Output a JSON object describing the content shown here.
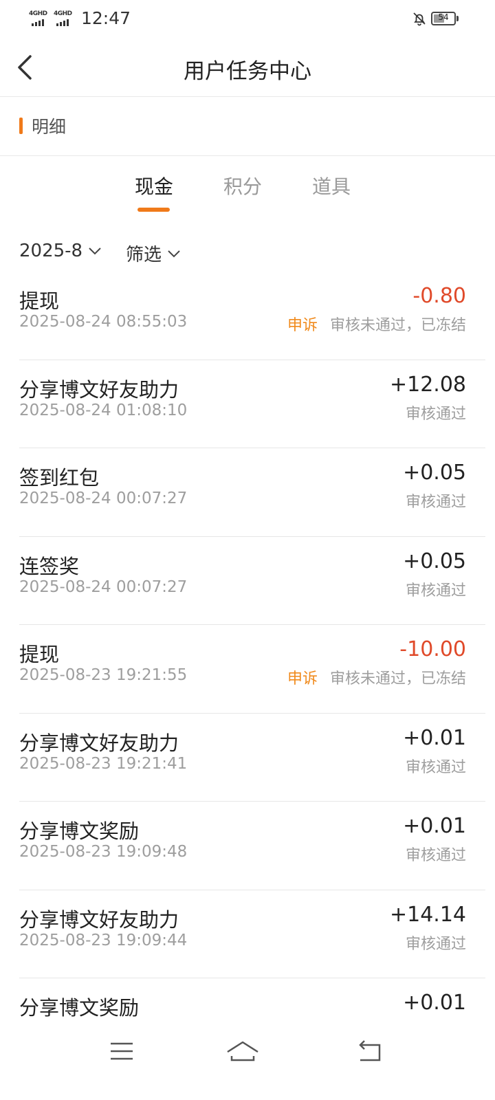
{
  "status_bar": {
    "network_1": "4GHD",
    "network_2": "4GHD",
    "time": "12:47",
    "battery": "54",
    "battery_level": 0.54
  },
  "header": {
    "title": "用户任务中心"
  },
  "section": {
    "label": "明细"
  },
  "tabs": [
    {
      "label": "现金",
      "active": true
    },
    {
      "label": "积分",
      "active": false
    },
    {
      "label": "道具",
      "active": false
    }
  ],
  "filters": {
    "month": "2025-8",
    "filter_label": "筛选"
  },
  "records": [
    {
      "name": "提现",
      "time": "2025-08-24 08:55:03",
      "amount": "-0.80",
      "negative": true,
      "appeal": "申诉",
      "status": "审核未通过，已冻结"
    },
    {
      "name": "分享博文好友助力",
      "time": "2025-08-24 01:08:10",
      "amount": "+12.08",
      "negative": false,
      "appeal": "",
      "status": "审核通过"
    },
    {
      "name": "签到红包",
      "time": "2025-08-24 00:07:27",
      "amount": "+0.05",
      "negative": false,
      "appeal": "",
      "status": "审核通过"
    },
    {
      "name": "连签奖",
      "time": "2025-08-24 00:07:27",
      "amount": "+0.05",
      "negative": false,
      "appeal": "",
      "status": "审核通过"
    },
    {
      "name": "提现",
      "time": "2025-08-23 19:21:55",
      "amount": "-10.00",
      "negative": true,
      "appeal": "申诉",
      "status": "审核未通过，已冻结"
    },
    {
      "name": "分享博文好友助力",
      "time": "2025-08-23 19:21:41",
      "amount": "+0.01",
      "negative": false,
      "appeal": "",
      "status": "审核通过"
    },
    {
      "name": "分享博文奖励",
      "time": "2025-08-23 19:09:48",
      "amount": "+0.01",
      "negative": false,
      "appeal": "",
      "status": "审核通过"
    },
    {
      "name": "分享博文好友助力",
      "time": "2025-08-23 19:09:44",
      "amount": "+14.14",
      "negative": false,
      "appeal": "",
      "status": "审核通过"
    },
    {
      "name": "分享博文奖励",
      "time": "",
      "amount": "+0.01",
      "negative": false,
      "appeal": "",
      "status": ""
    }
  ],
  "colors": {
    "accent": "#f07a1a",
    "negative": "#e04a2a",
    "appeal": "#f08a1c",
    "muted": "#9e9e9e"
  },
  "icons": {
    "back": "chevron-left-icon",
    "dropdown": "chevron-down-icon",
    "menu": "menu-icon",
    "home": "home-icon",
    "return": "back-arrow-icon",
    "mute": "bell-off-icon"
  }
}
